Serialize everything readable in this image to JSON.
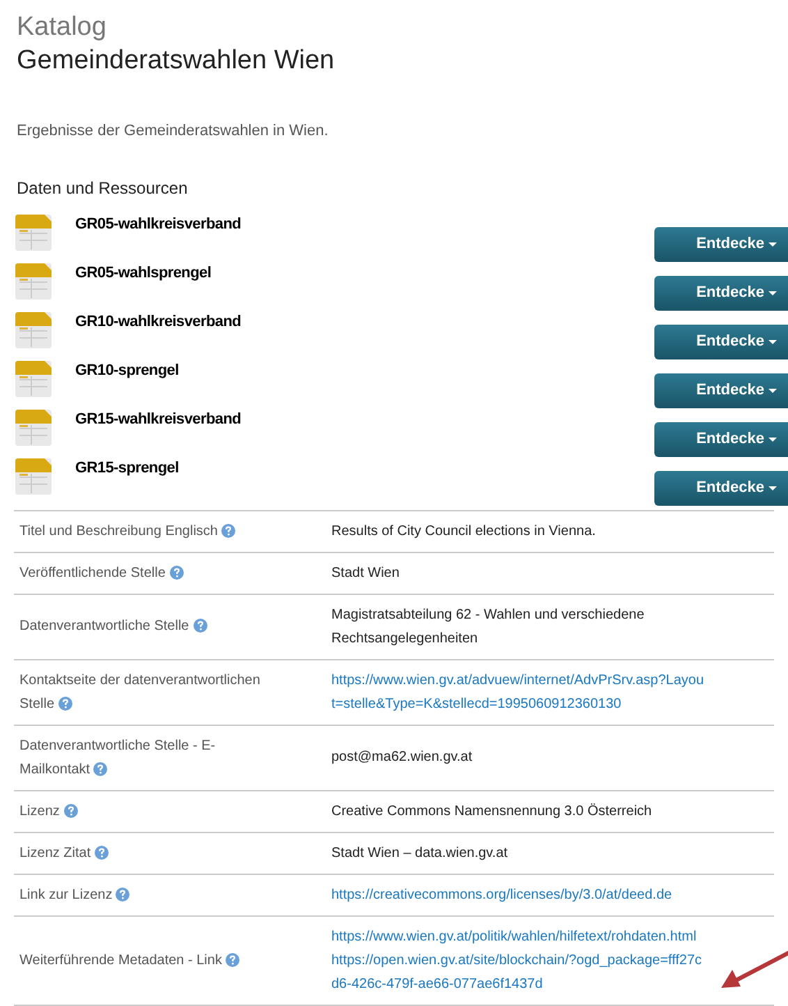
{
  "breadcrumb": "Katalog",
  "title": "Gemeinderatswahlen Wien",
  "description": "Ergebnisse der Gemeinderatswahlen in Wien.",
  "resources_heading": "Daten und Ressourcen",
  "resources": [
    {
      "name": "GR05-wahlkreisverband",
      "button": "Entdecke"
    },
    {
      "name": "GR05-wahlsprengel",
      "button": "Entdecke"
    },
    {
      "name": "GR10-wahlkreisverband",
      "button": "Entdecke"
    },
    {
      "name": "GR10-sprengel",
      "button": "Entdecke"
    },
    {
      "name": "GR15-wahlkreisverband",
      "button": "Entdecke"
    },
    {
      "name": "GR15-sprengel",
      "button": "Entdecke"
    }
  ],
  "metadata": [
    {
      "label": "Titel und Beschreibung Englisch",
      "kind": "text",
      "values": [
        "Results of City Council elections in Vienna."
      ]
    },
    {
      "label": "Veröffentlichende Stelle",
      "kind": "text",
      "values": [
        "Stadt Wien"
      ]
    },
    {
      "label": "Datenverantwortliche Stelle",
      "kind": "text",
      "values": [
        "Magistratsabteilung 62 - Wahlen und verschiedene Rechtsangelegenheiten"
      ]
    },
    {
      "label": "Kontaktseite der datenverantwortlichen Stelle",
      "kind": "link",
      "values": [
        "https://www.wien.gv.at/advuew/internet/AdvPrSrv.asp?Layout=stelle&Type=K&stellecd=1995060912360130"
      ]
    },
    {
      "label": "Datenverantwortliche Stelle - E-Mailkontakt",
      "kind": "text",
      "values": [
        "post@ma62.wien.gv.at"
      ]
    },
    {
      "label": "Lizenz",
      "kind": "text",
      "values": [
        "Creative Commons Namensnennung 3.0 Österreich"
      ]
    },
    {
      "label": "Lizenz Zitat",
      "kind": "text",
      "values": [
        "Stadt Wien – data.wien.gv.at"
      ]
    },
    {
      "label": "Link zur Lizenz",
      "kind": "link",
      "values": [
        "https://creativecommons.org/licenses/by/3.0/at/deed.de"
      ]
    },
    {
      "label": "Weiterführende Metadaten - Link",
      "kind": "link",
      "values": [
        "https://www.wien.gv.at/politik/wahlen/hilfetext/rohdaten.html",
        "https://open.wien.gv.at/site/blockchain/?ogd_package=fff27cd6-426c-479f-ae66-077ae6f1437d"
      ]
    }
  ]
}
